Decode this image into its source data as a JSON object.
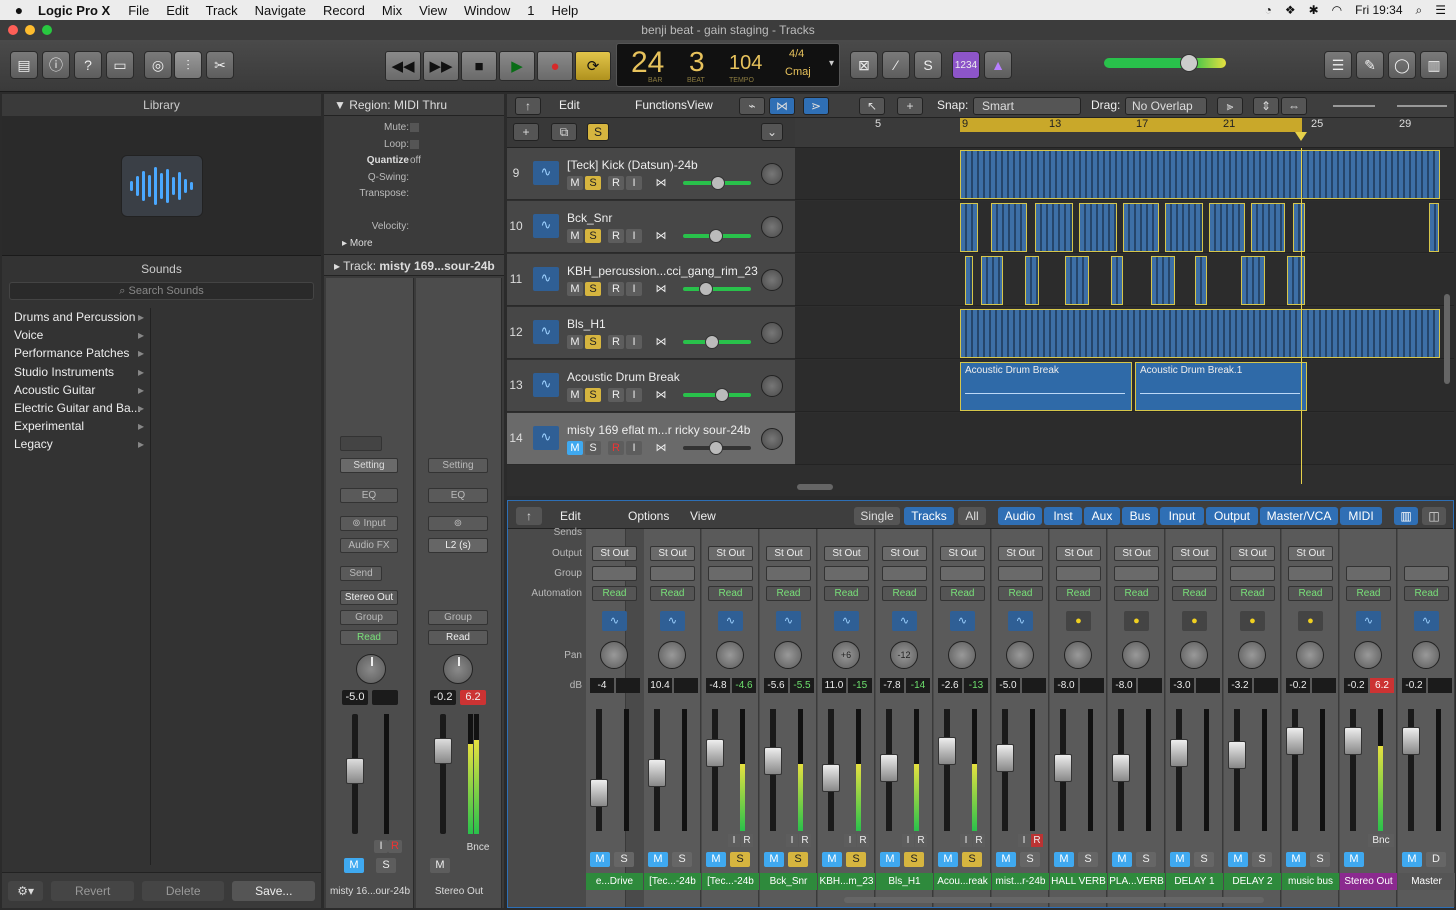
{
  "menubar": {
    "app": "Logic Pro X",
    "items": [
      "File",
      "Edit",
      "Track",
      "Navigate",
      "Record",
      "Mix",
      "View",
      "Window",
      "1",
      "Help"
    ],
    "clock": "Fri 19:34"
  },
  "window": {
    "title": "benji beat - gain staging - Tracks"
  },
  "lcd": {
    "bar": "24",
    "beat": "3",
    "bar_label": "BAR",
    "beat_label": "BEAT",
    "tempo": "104",
    "tempo_label": "TEMPO",
    "signature": "4/4",
    "key": "Cmaj"
  },
  "count_in": "1234",
  "library": {
    "title": "Library",
    "sounds_title": "Sounds",
    "search_placeholder": "Search Sounds",
    "categories": [
      "Drums and Percussion",
      "Voice",
      "Performance Patches",
      "Studio Instruments",
      "Acoustic Guitar",
      "Electric Guitar and Ba...",
      "Experimental",
      "Legacy"
    ],
    "revert": "Revert",
    "delete": "Delete",
    "save": "Save..."
  },
  "inspector": {
    "region_title": "Region: MIDI Thru",
    "mute_label": "Mute:",
    "loop_label": "Loop:",
    "quantize_label": "Quantize",
    "quantize_value": "off",
    "qswing_label": "Q-Swing:",
    "transpose_label": "Transpose:",
    "velocity_label": "Velocity:",
    "more_label": "More",
    "track_label": "Track:",
    "track_name": "misty 169...sour-24b",
    "strip1": {
      "setting": "Setting",
      "eq": "EQ",
      "input": "Input",
      "audiofx": "Audio FX",
      "send": "Send",
      "output": "Stereo Out",
      "group": "Group",
      "auto": "Read",
      "vol": "-5.0",
      "peak": "",
      "m": "M",
      "s": "S",
      "i": "I",
      "r": "R",
      "name": "misty 16...our-24b"
    },
    "strip2": {
      "setting": "Setting",
      "eq": "EQ",
      "insert": "L2 (s)",
      "group": "Group",
      "auto": "Read",
      "vol": "-0.2",
      "peak": "6.2",
      "m": "M",
      "bnce": "Bnce",
      "name": "Stereo Out"
    }
  },
  "tracks_toolbar": {
    "edit": "Edit",
    "functions": "Functions",
    "view": "View",
    "snap_label": "Snap:",
    "snap_value": "Smart",
    "drag_label": "Drag:",
    "drag_value": "No Overlap"
  },
  "ruler": {
    "marks": [
      "5",
      "9",
      "13",
      "17",
      "21",
      "25",
      "29"
    ]
  },
  "tracks": [
    {
      "num": "9",
      "name": "[Teck] Kick (Datsun)-24b"
    },
    {
      "num": "10",
      "name": "Bck_Snr"
    },
    {
      "num": "11",
      "name": "KBH_percussion...cci_gang_rim_23"
    },
    {
      "num": "12",
      "name": "Bls_H1"
    },
    {
      "num": "13",
      "name": "Acoustic Drum Break"
    },
    {
      "num": "14",
      "name": "misty 169 eflat m...r ricky sour-24b"
    }
  ],
  "track_buttons": {
    "m": "M",
    "s": "S",
    "r": "R",
    "i": "I"
  },
  "regions": {
    "a": "Acoustic Drum Break",
    "b": "Acoustic Drum Break.1"
  },
  "mixer_toolbar": {
    "edit": "Edit",
    "options": "Options",
    "view": "View",
    "single": "Single",
    "tracks": "Tracks",
    "all": "All",
    "filters": [
      "Audio",
      "Inst",
      "Aux",
      "Bus",
      "Input",
      "Output",
      "Master/VCA",
      "MIDI"
    ]
  },
  "mixer_labels": {
    "sends": "Sends",
    "output": "Output",
    "group": "Group",
    "automation": "Automation",
    "pan": "Pan",
    "db": "dB"
  },
  "mixer_strips": [
    {
      "output": "St Out",
      "auto": "Read",
      "pan": "",
      "vol": "-4",
      "peak": "",
      "name": "e...Drive",
      "solo": false,
      "kind": "track"
    },
    {
      "output": "St Out",
      "auto": "Read",
      "pan": "",
      "vol": "10.4",
      "peak": "",
      "name": "[Tec...-24b",
      "solo": false,
      "kind": "track"
    },
    {
      "output": "St Out",
      "auto": "Read",
      "pan": "",
      "vol": "-4.8",
      "peak": "-4.6",
      "name": "[Tec...-24b",
      "solo": true,
      "kind": "track"
    },
    {
      "output": "St Out",
      "auto": "Read",
      "pan": "",
      "vol": "-5.6",
      "peak": "-5.5",
      "name": "Bck_Snr",
      "solo": true,
      "kind": "track"
    },
    {
      "output": "St Out",
      "auto": "Read",
      "pan": "+6",
      "vol": "11.0",
      "peak": "-15",
      "name": "KBH...m_23",
      "solo": true,
      "kind": "track"
    },
    {
      "output": "St Out",
      "auto": "Read",
      "pan": "-12",
      "vol": "-7.8",
      "peak": "-14",
      "name": "Bls_H1",
      "solo": true,
      "kind": "track"
    },
    {
      "output": "St Out",
      "auto": "Read",
      "pan": "",
      "vol": "-2.6",
      "peak": "-13",
      "name": "Acou...reak",
      "solo": true,
      "kind": "track"
    },
    {
      "output": "St Out",
      "auto": "Read",
      "pan": "",
      "vol": "-5.0",
      "peak": "",
      "name": "mist...r-24b",
      "solo": false,
      "kind": "track"
    },
    {
      "output": "St Out",
      "auto": "Read",
      "pan": "",
      "vol": "-8.0",
      "peak": "",
      "name": "HALL VERB",
      "solo": false,
      "kind": "bus"
    },
    {
      "output": "St Out",
      "auto": "Read",
      "pan": "",
      "vol": "-8.0",
      "peak": "",
      "name": "PLA...VERB",
      "solo": false,
      "kind": "bus"
    },
    {
      "output": "St Out",
      "auto": "Read",
      "pan": "",
      "vol": "-3.0",
      "peak": "",
      "name": "DELAY 1",
      "solo": false,
      "kind": "bus"
    },
    {
      "output": "St Out",
      "auto": "Read",
      "pan": "",
      "vol": "-3.2",
      "peak": "",
      "name": "DELAY 2",
      "solo": false,
      "kind": "bus"
    },
    {
      "output": "St Out",
      "auto": "Read",
      "pan": "",
      "vol": "-0.2",
      "peak": "",
      "name": "music bus",
      "solo": false,
      "kind": "bus"
    },
    {
      "output": "",
      "auto": "Read",
      "pan": "",
      "vol": "-0.2",
      "peak": "6.2",
      "name": "Stereo Out",
      "solo": false,
      "kind": "out"
    },
    {
      "output": "",
      "auto": "Read",
      "pan": "",
      "vol": "-0.2",
      "peak": "",
      "name": "Master",
      "solo": false,
      "kind": "master"
    }
  ],
  "mixer_button_labels": {
    "m": "M",
    "s": "S",
    "d": "D",
    "i": "I",
    "r": "R",
    "bnc": "Bnc"
  },
  "colors": {
    "accent_blue": "#2f6fb5",
    "solo_yellow": "#d6b53f",
    "cycle": "#c9a82a",
    "play_green": "#29c14b",
    "record_red": "#d62a2a"
  }
}
